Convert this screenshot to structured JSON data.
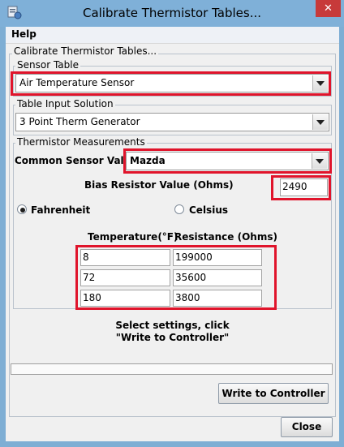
{
  "window": {
    "title": "Calibrate Thermistor Tables...",
    "close_glyph": "✕"
  },
  "menu": {
    "help": "Help"
  },
  "outer_group": {
    "title": "Calibrate Thermistor Tables..."
  },
  "sensor_table": {
    "title": "Sensor Table",
    "selected": "Air Temperature Sensor"
  },
  "table_input": {
    "title": "Table Input Solution",
    "selected": "3 Point Therm Generator"
  },
  "thermistor": {
    "title": "Thermistor Measurements",
    "common_label": "Common Sensor Values",
    "common_selected": "Mazda",
    "bias_label": "Bias Resistor Value (Ohms)",
    "bias_value": "2490",
    "fahrenheit": "Fahrenheit",
    "celsius": "Celsius",
    "unit_selected": "Fahrenheit",
    "temp_header": "Temperature(°F)",
    "resistance_header": "Resistance (Ohms)",
    "rows": [
      {
        "temp": "8",
        "resistance": "199000"
      },
      {
        "temp": "72",
        "resistance": "35600"
      },
      {
        "temp": "180",
        "resistance": "3800"
      }
    ]
  },
  "status": {
    "line1": "Select settings, click",
    "line2": "\"Write to Controller\""
  },
  "progress": {
    "value": 0
  },
  "buttons": {
    "write": "Write to Controller",
    "close": "Close"
  },
  "colors": {
    "highlight": "#e0142b",
    "titlebar": "#7fb0d8",
    "close_button": "#c73a3a"
  }
}
